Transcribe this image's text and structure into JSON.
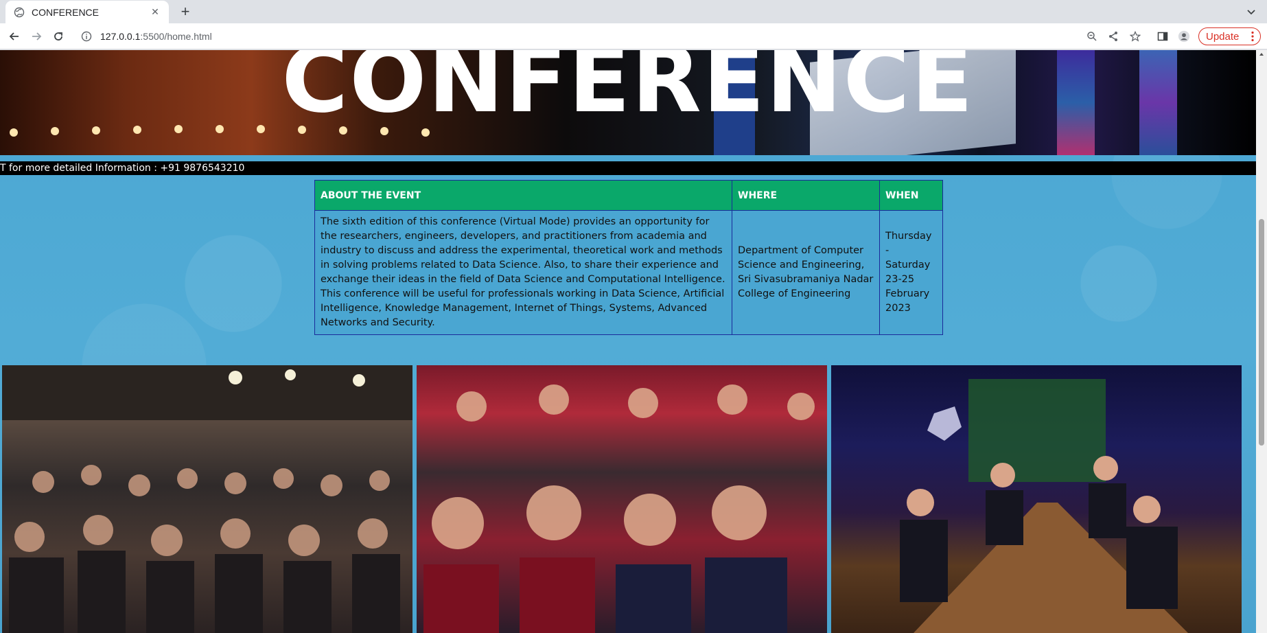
{
  "browser": {
    "tab_title": "CONFERENCE",
    "url_host": "127.0.0.1",
    "url_path": ":5500/home.html",
    "update_label": "Update"
  },
  "page": {
    "hero_title": "CONFERENCE",
    "marquee_text": "T for more detailed Information : +91 9876543210",
    "table": {
      "headers": [
        "ABOUT THE EVENT",
        "WHERE",
        "WHEN"
      ],
      "about": "The sixth edition of this conference (Virtual Mode) provides an opportunity for the researchers, engineers, developers, and practitioners from academia and industry to discuss and address the experimental, theoretical work and methods in solving problems related to Data Science. Also, to share their experience and exchange their ideas in the field of Data Science and Computational Intelligence. This conference will be useful for professionals working in Data Science, Artificial Intelligence, Knowledge Management, Internet of Things, Systems, Advanced Networks and Security.",
      "where": "Department of Computer Science and Engineering, Sri Sivasubramaniya Nadar College of Engineering",
      "when": "Thursday - Saturday 23-25 February 2023"
    }
  },
  "colors": {
    "page_background": "#4aa6d2",
    "table_header": "#0aa86a",
    "table_border": "#1a2a9a",
    "update_accent": "#d93025"
  }
}
